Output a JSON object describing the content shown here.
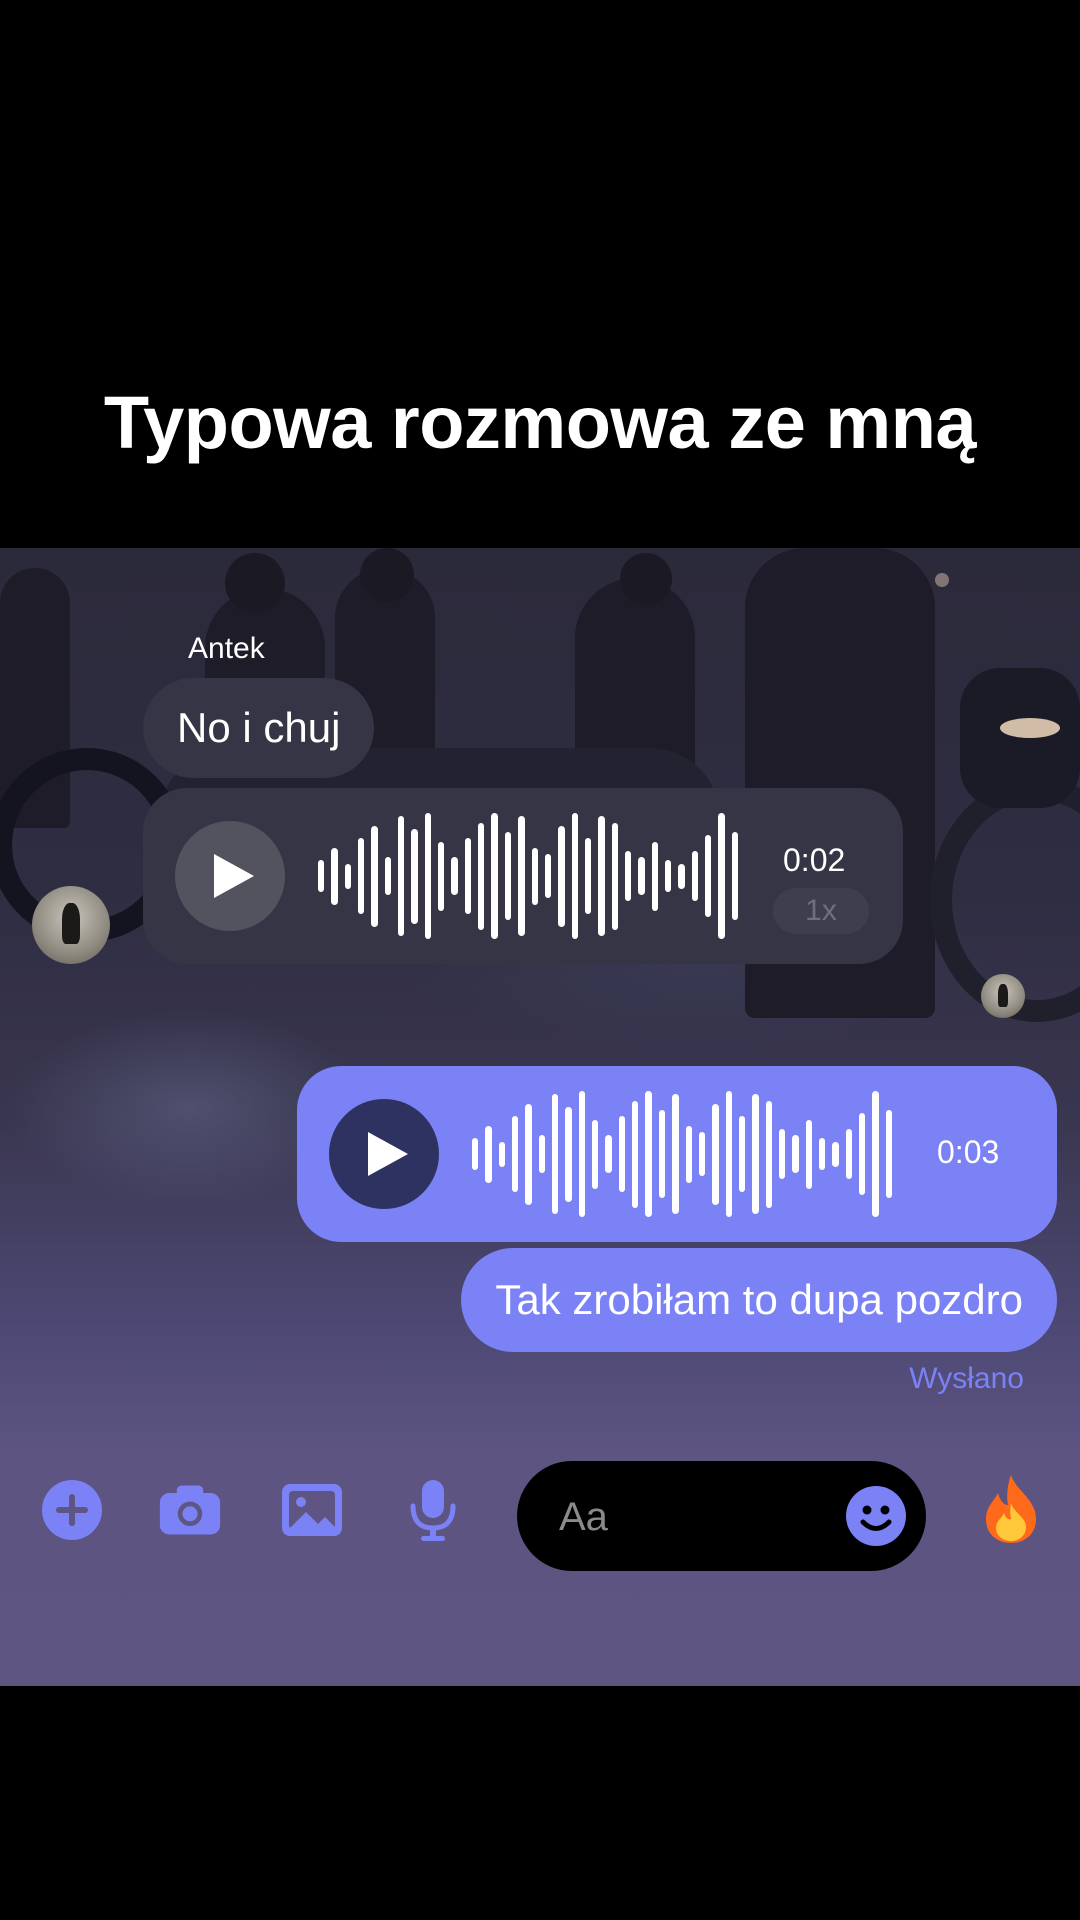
{
  "caption": "Typowa rozmowa ze mną",
  "chat": {
    "incoming": {
      "sender_name": "Antek",
      "text_message": "No i chuj",
      "voice_message": {
        "duration": "0:02",
        "speed": "1x",
        "waveform": [
          0.25,
          0.45,
          0.2,
          0.6,
          0.8,
          0.3,
          0.95,
          0.75,
          1.0,
          0.55,
          0.3,
          0.6,
          0.85,
          1.0,
          0.7,
          0.95,
          0.45,
          0.35,
          0.8,
          1.0,
          0.6,
          0.95,
          0.85,
          0.4,
          0.3,
          0.55,
          0.25,
          0.2,
          0.4,
          0.65,
          1.0,
          0.7
        ]
      },
      "avatar_icon": "avatar-photo"
    },
    "outgoing": {
      "voice_message": {
        "duration": "0:03",
        "waveform": [
          0.25,
          0.45,
          0.2,
          0.6,
          0.8,
          0.3,
          0.95,
          0.75,
          1.0,
          0.55,
          0.3,
          0.6,
          0.85,
          1.0,
          0.7,
          0.95,
          0.45,
          0.35,
          0.8,
          1.0,
          0.6,
          0.95,
          0.85,
          0.4,
          0.3,
          0.55,
          0.25,
          0.2,
          0.4,
          0.65,
          1.0,
          0.7
        ]
      },
      "text_message": "Tak zrobiłam to dupa pozdro",
      "status": "Wysłano",
      "seen_avatar_icon": "seen-avatar"
    }
  },
  "composer": {
    "placeholder": "Aa",
    "icons": [
      "plus-icon",
      "camera-icon",
      "image-icon",
      "microphone-icon",
      "emoji-icon",
      "fire-icon"
    ],
    "quick_reaction": "🔥"
  },
  "colors": {
    "accent": "#7b82f5",
    "incoming_bubble": "#353545",
    "outgoing_play": "#2e3260"
  }
}
